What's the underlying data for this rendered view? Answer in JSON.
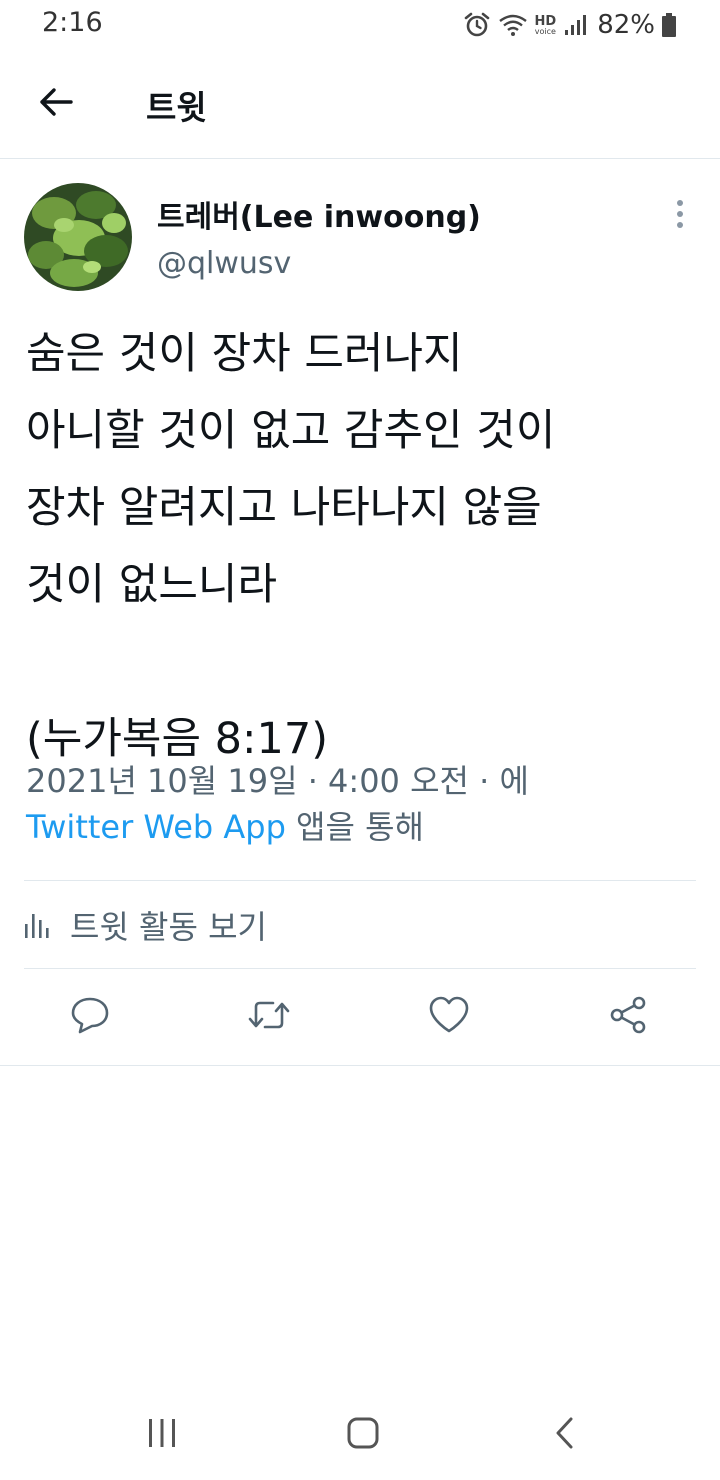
{
  "status_bar": {
    "time": "2:16",
    "hd_label": "HD",
    "voice_label": "voice",
    "battery": "82%"
  },
  "header": {
    "title": "트윗",
    "back_icon": "arrow-left-icon"
  },
  "tweet": {
    "author_name": "트레버(Lee inwoong)",
    "author_handle": "@qlwusv",
    "text": "숨은 것이 장차 드러나지\n아니할 것이 없고 감추인 것이\n장차 알려지고 나타나지 않을\n것이 없느니라\n\n(누가복음 8:17)",
    "timestamp": "2021년 10월 19일 · 4:00 오전 · 에",
    "source_app": "Twitter Web App",
    "source_suffix": " 앱을 통해"
  },
  "activity": {
    "label": "트윗 활동 보기"
  },
  "actions": {
    "icons": [
      "reply-icon",
      "retweet-icon",
      "like-icon",
      "share-icon"
    ]
  },
  "colors": {
    "link": "#1d9bf0",
    "secondary_text": "#536471",
    "divider": "#e1e8ed"
  }
}
